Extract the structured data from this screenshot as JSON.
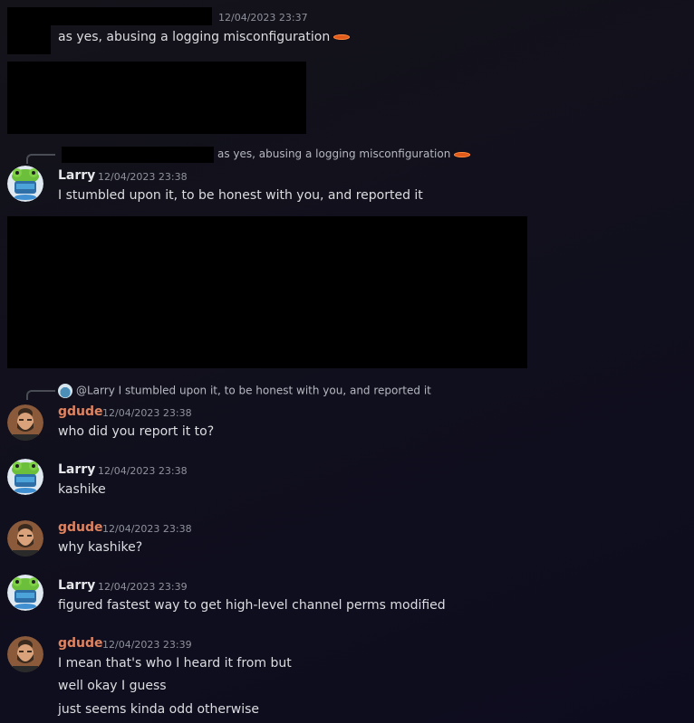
{
  "messages": {
    "m1": {
      "timestamp": "12/04/2023 23:37",
      "text": "as yes, abusing a logging misconfiguration"
    },
    "m2": {
      "reply_preview": "as yes, abusing a logging misconfiguration",
      "author": "Larry",
      "timestamp": "12/04/2023 23:38",
      "text": "I stumbled upon it, to be honest with you, and reported it"
    },
    "m3": {
      "reply_preview": "@Larry I stumbled upon it, to be honest with you, and reported it",
      "author": "gdude",
      "timestamp": "12/04/2023 23:38",
      "text": "who did you report it to?"
    },
    "m4": {
      "author": "Larry",
      "timestamp": "12/04/2023 23:38",
      "text": "kashike"
    },
    "m5": {
      "author": "gdude",
      "timestamp": "12/04/2023 23:38",
      "text": "why kashike?"
    },
    "m6": {
      "author": "Larry",
      "timestamp": "12/04/2023 23:39",
      "text": "figured fastest way to get high-level channel perms modified"
    },
    "m7": {
      "author": "gdude",
      "timestamp": "12/04/2023 23:39",
      "lines": [
        "I mean that's who I heard it from but",
        "well okay I guess",
        "just seems kinda odd otherwise"
      ]
    }
  },
  "colors": {
    "larry": "#e6e7ea",
    "gdude": "#e0835f",
    "background": "#100f1d",
    "emoji": "#e05a1c"
  },
  "icons": {
    "larry_avatar": "frog-avatar-icon",
    "gdude_avatar": "bearded-man-avatar-icon",
    "emoji": "orange-emoji-icon"
  }
}
